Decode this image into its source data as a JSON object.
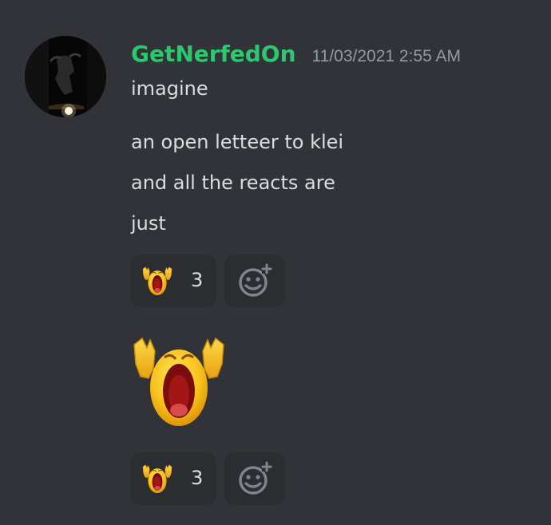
{
  "message": {
    "author": "GetNerfedOn",
    "timestamp": "11/03/2021 2:55 AM",
    "author_color": "#2dc770",
    "avatar_icon": "dark-figure-avatar",
    "lines": [
      "imagine",
      "an open letteer to klei",
      "and all the reacts are",
      "just"
    ]
  },
  "reactions": [
    {
      "emoji": "screaming-crying-emoji",
      "count": "3"
    },
    {
      "emoji": "screaming-crying-emoji",
      "count": "3"
    }
  ],
  "add_reaction_icon": "add-reaction-icon",
  "sent_emoji": "screaming-crying-emoji",
  "colors": {
    "background": "#313338",
    "reaction_bg": "#2b2d31",
    "text": "#dbdee1",
    "muted": "#949ba4"
  }
}
